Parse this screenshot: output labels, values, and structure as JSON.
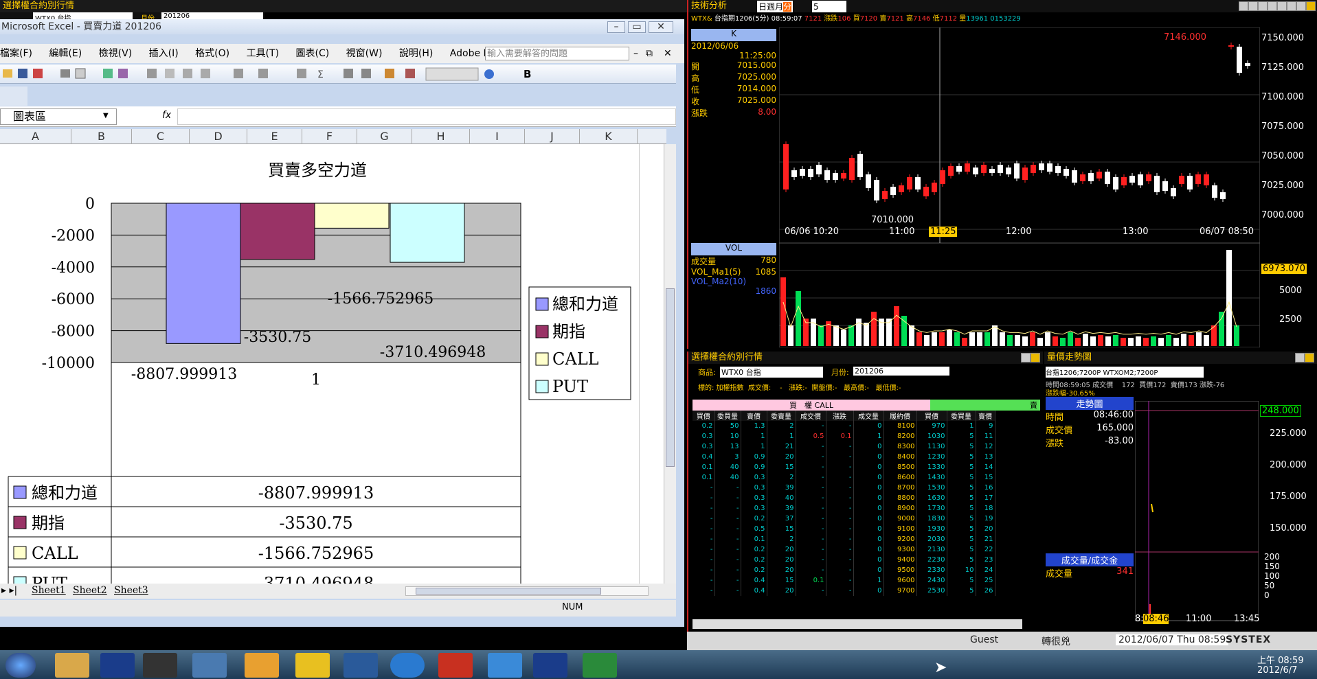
{
  "top_left_panel": {
    "title": "選擇權合約別行情",
    "product": "WTX0 台指",
    "month_label": "月份",
    "month": "201206"
  },
  "excel": {
    "window_title": "Microsoft Excel - 買賣力道 201206",
    "menu": [
      "檔案(F)",
      "編輯(E)",
      "檢視(V)",
      "插入(I)",
      "格式(O)",
      "工具(T)",
      "圖表(C)",
      "視窗(W)",
      "說明(H)",
      "Adobe PDF(B)"
    ],
    "help_placeholder": "輸入需要解答的問題",
    "name_box": "圖表區",
    "fx": "fx",
    "columns": [
      "A",
      "B",
      "C",
      "D",
      "E",
      "F",
      "G",
      "H",
      "I",
      "J",
      "K"
    ],
    "sheets": [
      "Sheet1",
      "Sheet2",
      "Sheet3"
    ],
    "status_num": "NUM",
    "bold_btn": "B"
  },
  "chart_data": {
    "type": "bar",
    "title": "買賣多空力道",
    "categories": [
      "1"
    ],
    "series": [
      {
        "name": "總和力道",
        "values": [
          -8807.999913
        ],
        "label": "-8807.999913",
        "color": "#9999ff"
      },
      {
        "name": "期指",
        "values": [
          -3530.75
        ],
        "label": "-3530.75",
        "color": "#993366"
      },
      {
        "name": "CALL",
        "values": [
          -1566.752965
        ],
        "label": "-1566.752965",
        "color": "#ffffcc"
      },
      {
        "name": "PUT",
        "values": [
          -3710.496948
        ],
        "label": "-3710.496948",
        "color": "#ccffff"
      }
    ],
    "yticks": [
      "0",
      "-2000",
      "-4000",
      "-6000",
      "-8000",
      "-10000"
    ],
    "ylim": [
      -10000,
      0
    ],
    "legend": "right",
    "data_table": true
  },
  "tech": {
    "title": "技術分析",
    "period": [
      "日",
      "週",
      "月",
      "分"
    ],
    "interval": "5",
    "quote_line": {
      "symbol": "WTX&",
      "name": "台指期1206(5分)",
      "time": "08:59:07",
      "price": "7121",
      "chg_label": "漲跌",
      "chg": "106",
      "bid_label": "買",
      "bid": "7120",
      "ask_label": "賣",
      "ask": "7121",
      "high_label": "高",
      "high": "7146",
      "low_label": "低",
      "low": "7112",
      "vol_label": "量",
      "vol": "13961",
      "extra": "0153229"
    },
    "k_label": "K",
    "info": {
      "date": "2012/06/06",
      "time": "11:25:00",
      "open_label": "開",
      "open": "7015.000",
      "high_label": "高",
      "high": "7025.000",
      "low_label": "低",
      "low": "7014.000",
      "close_label": "收",
      "close": "7025.000",
      "chg_label": "漲跌",
      "chg": "8.00"
    },
    "price_axis": [
      "7150.000",
      "7125.000",
      "7100.000",
      "7075.000",
      "7050.000",
      "7025.000",
      "7000.000"
    ],
    "time_axis": [
      "06/06 10:20",
      "11:00",
      "11:25",
      "12:00",
      "13:00",
      "06/07 08:50"
    ],
    "peak_label": "7146.000",
    "low_mark": "7010.000",
    "vol_label": "VOL",
    "vol_info": {
      "vol_label": "成交量",
      "vol": "780",
      "ma1_label": "VOL_Ma1(5)",
      "ma1": "1085",
      "ma2_label": "VOL_Ma2(10)",
      "ma2": "1860"
    },
    "vol_axis": [
      "6973.070",
      "5000",
      "2500"
    ]
  },
  "opt": {
    "title": "選擇權合約別行情",
    "product_label": "商品:",
    "product": "WTX0 台指",
    "month_label": "月份:",
    "month": "201206",
    "sub": "標的: 加權指數  成交價:    -   漲跌:-  開盤價:-   最高價:-   最低價:-",
    "call_header": "買　權 CALL",
    "put_header": "賣",
    "cols": [
      "買價",
      "委買量",
      "賣價",
      "委賣量",
      "成交價",
      "漲跌",
      "成交量",
      "履約價",
      "買價",
      "委買量",
      "賣價"
    ],
    "rows": [
      [
        "0.2",
        "50",
        "1.3",
        "2",
        "-",
        "-",
        "0",
        "8100",
        "970",
        "1",
        "9"
      ],
      [
        "0.3",
        "10",
        "1",
        "1",
        "0.5",
        "0.1",
        "1",
        "8200",
        "1030",
        "5",
        "11"
      ],
      [
        "0.3",
        "13",
        "1",
        "21",
        "-",
        "-",
        "0",
        "8300",
        "1130",
        "5",
        "12"
      ],
      [
        "0.4",
        "3",
        "0.9",
        "20",
        "-",
        "-",
        "0",
        "8400",
        "1230",
        "5",
        "13"
      ],
      [
        "0.1",
        "40",
        "0.9",
        "15",
        "-",
        "-",
        "0",
        "8500",
        "1330",
        "5",
        "14"
      ],
      [
        "0.1",
        "40",
        "0.3",
        "2",
        "-",
        "-",
        "0",
        "8600",
        "1430",
        "5",
        "15"
      ],
      [
        "-",
        "-",
        "0.3",
        "39",
        "-",
        "-",
        "0",
        "8700",
        "1530",
        "5",
        "16"
      ],
      [
        "-",
        "-",
        "0.3",
        "40",
        "-",
        "-",
        "0",
        "8800",
        "1630",
        "5",
        "17"
      ],
      [
        "-",
        "-",
        "0.3",
        "39",
        "-",
        "-",
        "0",
        "8900",
        "1730",
        "5",
        "18"
      ],
      [
        "-",
        "-",
        "0.2",
        "37",
        "-",
        "-",
        "0",
        "9000",
        "1830",
        "5",
        "19"
      ],
      [
        "-",
        "-",
        "0.5",
        "15",
        "-",
        "-",
        "0",
        "9100",
        "1930",
        "5",
        "20"
      ],
      [
        "-",
        "-",
        "0.1",
        "2",
        "-",
        "-",
        "0",
        "9200",
        "2030",
        "5",
        "21"
      ],
      [
        "-",
        "-",
        "0.2",
        "20",
        "-",
        "-",
        "0",
        "9300",
        "2130",
        "5",
        "22"
      ],
      [
        "-",
        "-",
        "0.2",
        "20",
        "-",
        "-",
        "0",
        "9400",
        "2230",
        "5",
        "23"
      ],
      [
        "-",
        "-",
        "0.2",
        "20",
        "-",
        "-",
        "0",
        "9500",
        "2330",
        "10",
        "24"
      ],
      [
        "-",
        "-",
        "0.4",
        "15",
        "0.1",
        "-",
        "1",
        "9600",
        "2430",
        "5",
        "25"
      ],
      [
        "-",
        "-",
        "0.4",
        "20",
        "-",
        "-",
        "0",
        "9700",
        "2530",
        "5",
        "26"
      ]
    ]
  },
  "trend": {
    "title": "量價走勢圖",
    "symbol": "台指1206;7200P",
    "code": "WTXOM2;7200P",
    "line1": "時間08:59:05 成交價    172  買價172  賣價173 漲跌-76",
    "line2": "漲跌幅-30.65%",
    "sub_title": "走勢圖",
    "time_label": "時間",
    "time": "08:46:00",
    "price_label": "成交價",
    "price": "165.000",
    "chg_label": "漲跌",
    "chg": "-83.00",
    "axis": [
      "248.000",
      "225.000",
      "200.000",
      "175.000",
      "150.000"
    ],
    "vol_title": "成交量/成交金",
    "vol_label": "成交量",
    "vol": "341",
    "vol_axis": [
      "200",
      "150",
      "100",
      "50",
      "0"
    ],
    "time_axis": [
      "8:",
      "08:46",
      "11:00",
      "13:45"
    ]
  },
  "status": {
    "user": "Guest",
    "name": "轉很兇",
    "datetime": "2012/06/07 Thu 08:59",
    "brand": "SYSTEX"
  },
  "taskbar": {
    "time": "上午 08:59",
    "date": "2012/6/7"
  }
}
